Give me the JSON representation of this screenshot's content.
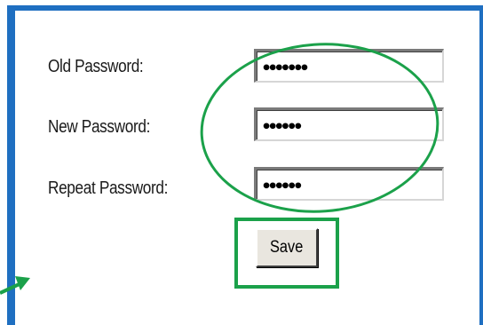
{
  "form": {
    "old_password": {
      "label": "Old Password:",
      "value_masked": "•••••••"
    },
    "new_password": {
      "label": "New Password:",
      "value_masked": "••••••"
    },
    "repeat_password": {
      "label": "Repeat Password:",
      "value_masked": "••••••"
    },
    "save_label": "Save"
  },
  "colors": {
    "frame_border": "#1f6fc1",
    "annotation_green": "#1ba14a",
    "button_face": "#e9e6df"
  },
  "annotations": {
    "fields_highlight": "ellipse",
    "save_highlight": "rectangle",
    "pointer": "arrow"
  }
}
